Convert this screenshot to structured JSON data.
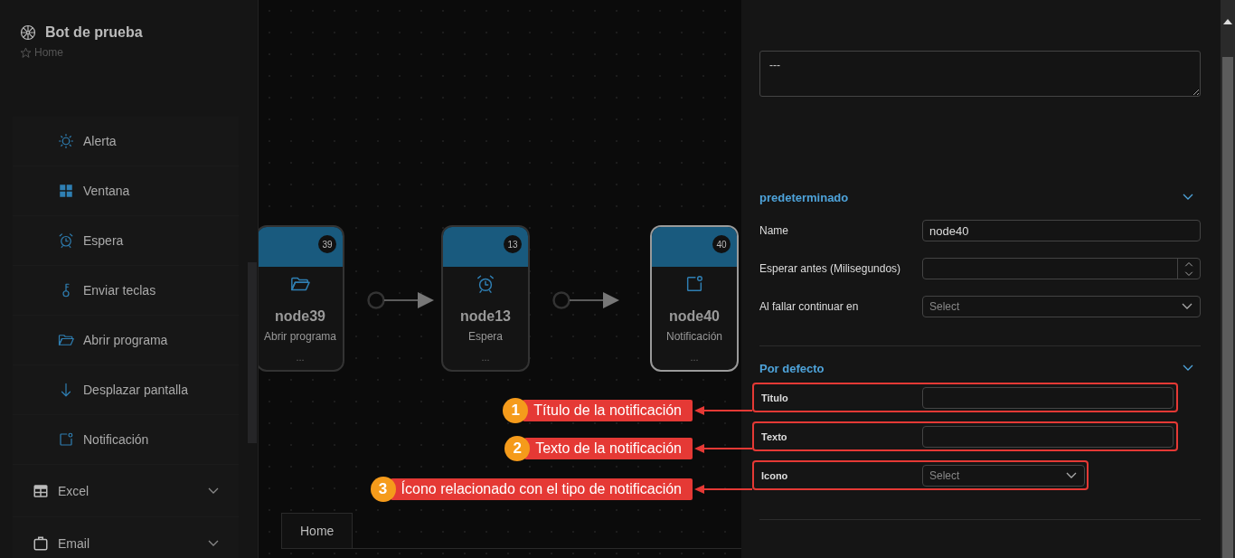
{
  "sidebar": {
    "title": "Bot de prueba",
    "breadcrumb": "Home",
    "items": [
      {
        "kind": "alert",
        "label": "Alerta"
      },
      {
        "kind": "window",
        "label": "Ventana"
      },
      {
        "kind": "wait",
        "label": "Espera"
      },
      {
        "kind": "keys",
        "label": "Enviar teclas"
      },
      {
        "kind": "open_program",
        "label": "Abrir programa"
      },
      {
        "kind": "scroll",
        "label": "Desplazar pantalla"
      },
      {
        "kind": "notification",
        "label": "Notificación"
      }
    ],
    "groups": [
      {
        "kind": "excel",
        "label": "Excel"
      },
      {
        "kind": "email",
        "label": "Email"
      }
    ]
  },
  "canvas": {
    "nodes": [
      {
        "kind": "open_program",
        "badge": "39",
        "name": "node39",
        "type": "Abrir programa",
        "footer": "...",
        "selected": false
      },
      {
        "kind": "wait",
        "badge": "13",
        "name": "node13",
        "type": "Espera",
        "footer": "...",
        "selected": false
      },
      {
        "kind": "notification",
        "badge": "40",
        "name": "node40",
        "type": "Notificación",
        "footer": "...",
        "selected": true
      }
    ],
    "tabs": [
      {
        "label": "Home",
        "selected": true
      }
    ]
  },
  "panel": {
    "description": "---",
    "sections": [
      {
        "title": "predeterminado",
        "fields": [
          {
            "kind": "text",
            "label": "Name",
            "value": "node40",
            "highlighted": false
          },
          {
            "kind": "number",
            "label": "Esperar antes (Milisegundos)",
            "highlighted": false
          },
          {
            "kind": "select",
            "label": "Al fallar continuar en",
            "placeholder": "Select",
            "highlighted": false
          }
        ]
      },
      {
        "title": "Por defecto",
        "fields": [
          {
            "kind": "text",
            "label": "Titulo",
            "highlighted": true
          },
          {
            "kind": "text",
            "label": "Texto",
            "highlighted": true
          },
          {
            "kind": "select",
            "label": "Icono",
            "placeholder": "Select",
            "highlighted": true
          }
        ]
      }
    ]
  },
  "annotations": [
    {
      "number": "1",
      "text": "Título de la notificación"
    },
    {
      "number": "2",
      "text": "Texto de la notificación"
    },
    {
      "number": "3",
      "text": "Ícono relacionado con el tipo de notificación"
    }
  ]
}
